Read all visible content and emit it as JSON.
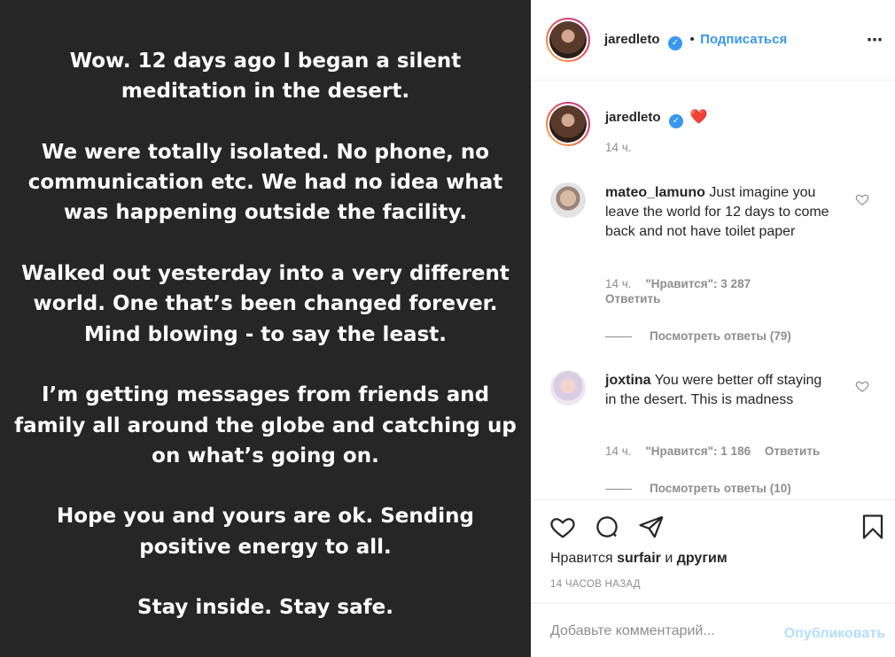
{
  "post": {
    "paragraphs": [
      "Wow. 12 days ago I began a silent meditation in the desert.",
      "We were totally isolated. No phone, no communication etc. We had no idea what was happening outside the facility.",
      "Walked out yesterday into a very different world. One that’s been changed forever. Mind blowing - to say the least.",
      "I’m getting messages from friends and family all around the globe and catching up on what’s going on.",
      "Hope you and yours are ok. Sending positive energy to all.",
      "Stay inside. Stay safe."
    ]
  },
  "header": {
    "username": "jaredleto",
    "separator": "•",
    "follow_label": "Подписаться",
    "more_icon": "⋯"
  },
  "caption": {
    "username": "jaredleto",
    "emoji": "❤️",
    "time": "14 ч."
  },
  "comments": [
    {
      "username": "mateo_lamuno",
      "text": "Just imagine you leave the world for 12 days to come back and not have toilet paper",
      "time": "14 ч.",
      "likes": "\"Нравится\": 3 287",
      "reply_label": "Ответить",
      "view_replies": "Посмотреть ответы (79)"
    },
    {
      "username": "joxtina",
      "text": "You were better off staying in the desert. This is madness",
      "time": "14 ч.",
      "likes": "\"Нравится\": 1 186",
      "reply_label": "Ответить",
      "view_replies": "Посмотреть ответы (10)"
    }
  ],
  "likes": {
    "prefix": "Нравится",
    "user": "surfair",
    "conj": "и",
    "others": "другим"
  },
  "time_ago": "14 ЧАСОВ НАЗАД",
  "comment_box": {
    "placeholder": "Добавьте комментарий...",
    "publish_label": "Опубликовать"
  },
  "colors": {
    "image_bg": "#262626",
    "accent": "#3897f0",
    "muted": "#8e8e8e",
    "publish_disabled": "#b2dffc",
    "heart": "#ed4956"
  }
}
